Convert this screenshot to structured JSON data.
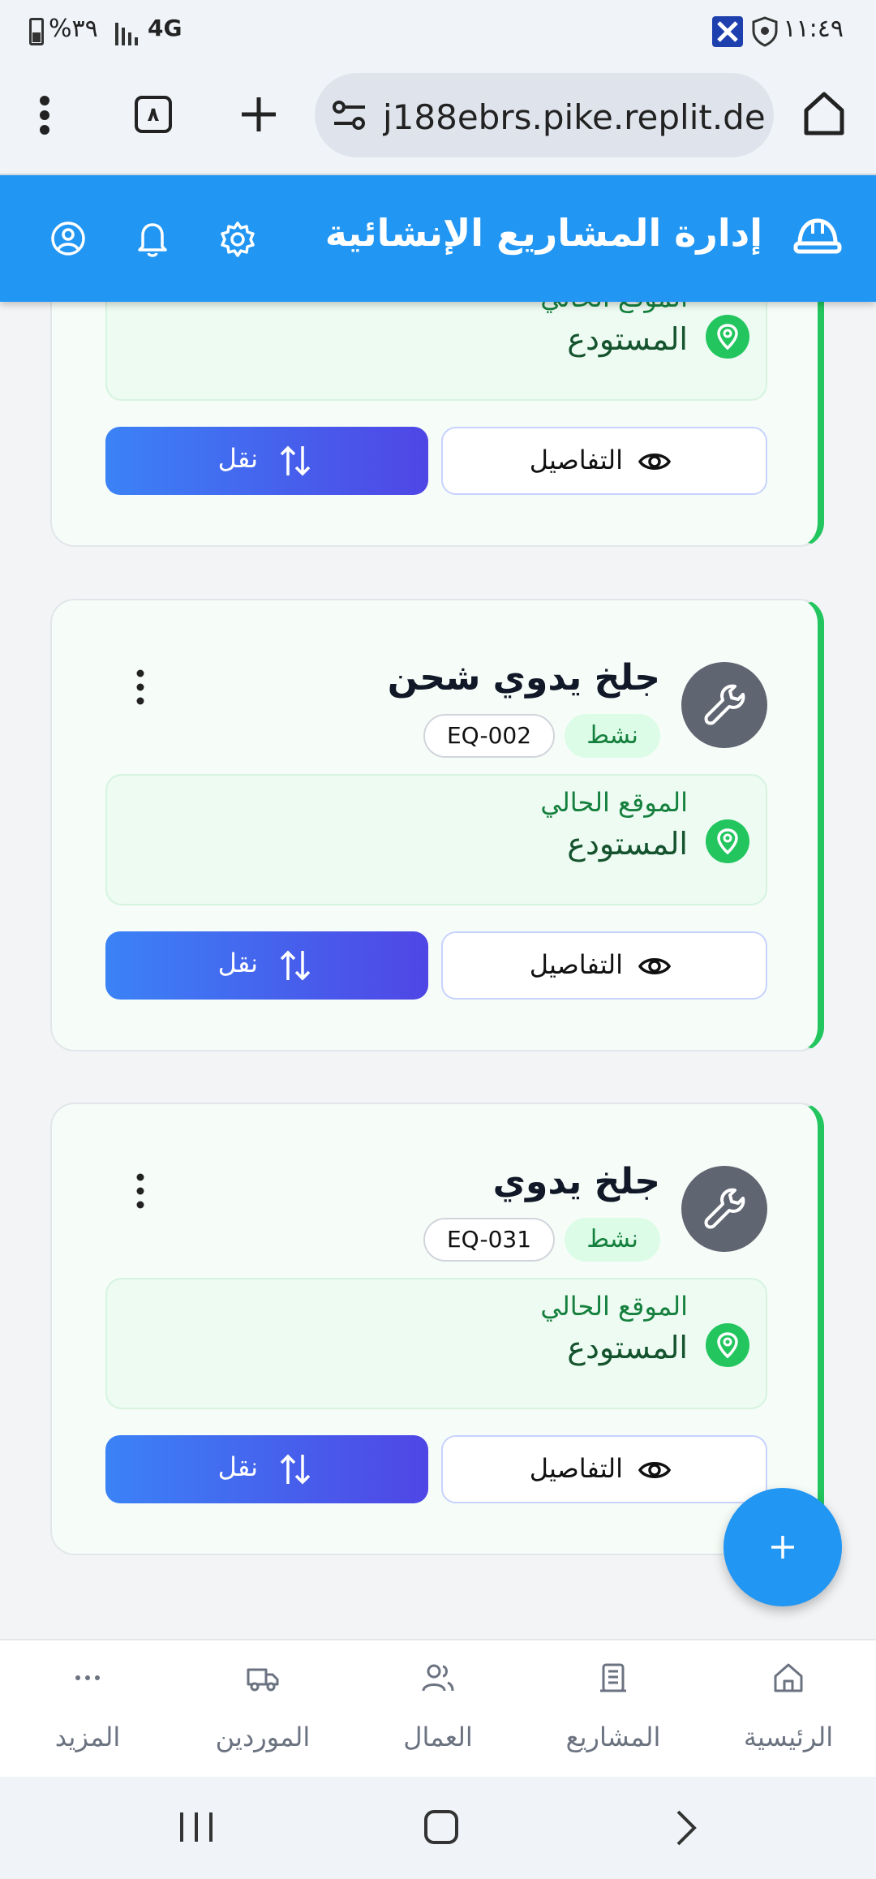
{
  "status_bar": {
    "time": "١١:٤٩",
    "battery": "%٣٩",
    "network": "4G"
  },
  "browser": {
    "url": "j188ebrs.pike.replit.dev",
    "tab_count": "٨"
  },
  "app_header": {
    "title": "إدارة المشاريع الإنشائية",
    "color": "#2196f3"
  },
  "cards": [
    {
      "location_label": "الموقع الحالي",
      "location_value": "المستودع",
      "details_label": "التفاصيل",
      "move_label": "نقل"
    },
    {
      "name": "جلخ يدوي شحن",
      "status": "نشط",
      "code": "EQ-002",
      "location_label": "الموقع الحالي",
      "location_value": "المستودع",
      "details_label": "التفاصيل",
      "move_label": "نقل"
    },
    {
      "name": "جلخ يدوي",
      "status": "نشط",
      "code": "EQ-031",
      "location_label": "الموقع الحالي",
      "location_value": "المستودع",
      "details_label": "التفاصيل",
      "move_label": "نقل"
    }
  ],
  "bottom_nav": {
    "items": [
      {
        "label": "الرئيسية",
        "icon": "home-icon"
      },
      {
        "label": "المشاريع",
        "icon": "projects-icon"
      },
      {
        "label": "العمال",
        "icon": "workers-icon"
      },
      {
        "label": "الموردين",
        "icon": "truck-icon"
      },
      {
        "label": "المزيد",
        "icon": "more-icon"
      }
    ]
  },
  "colors": {
    "accent": "#2196f3",
    "active_green": "#22c55e",
    "move_gradient_start": "#3b82f6",
    "move_gradient_end": "#4f46e5"
  }
}
